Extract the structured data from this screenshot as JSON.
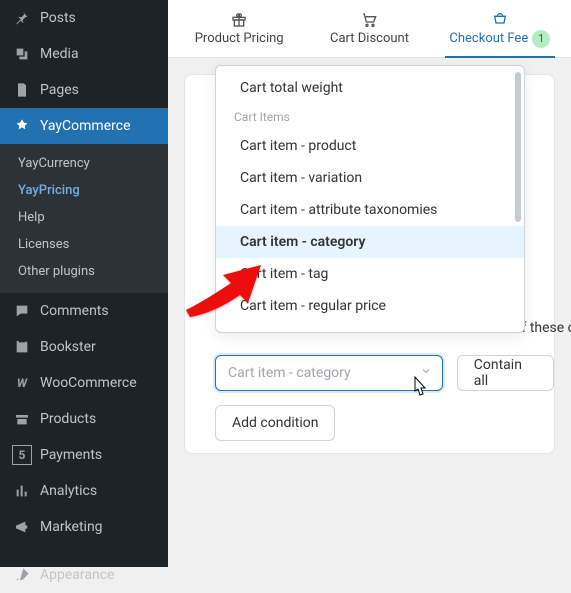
{
  "sidebar": {
    "items": [
      {
        "label": "Posts"
      },
      {
        "label": "Media"
      },
      {
        "label": "Pages"
      },
      {
        "label": "YayCommerce"
      },
      {
        "label": "Comments"
      },
      {
        "label": "Bookster"
      },
      {
        "label": "WooCommerce"
      },
      {
        "label": "Products"
      },
      {
        "label": "Payments"
      },
      {
        "label": "Analytics"
      },
      {
        "label": "Marketing"
      },
      {
        "label": "Appearance"
      }
    ],
    "submenu": [
      {
        "label": "YayCurrency"
      },
      {
        "label": "YayPricing"
      },
      {
        "label": "Help"
      },
      {
        "label": "Licenses"
      },
      {
        "label": "Other plugins"
      }
    ],
    "submenu_active_index": 1
  },
  "tabs": {
    "items": [
      {
        "label": "Product Pricing"
      },
      {
        "label": "Cart Discount"
      },
      {
        "label": "Checkout Fee",
        "badge": "1"
      }
    ],
    "active_index": 2
  },
  "dropdown": {
    "items": [
      {
        "type": "item",
        "label": "Cart total weight"
      },
      {
        "type": "group",
        "label": "Cart Items"
      },
      {
        "type": "item",
        "label": "Cart item - product"
      },
      {
        "type": "item",
        "label": "Cart item - variation"
      },
      {
        "type": "item",
        "label": "Cart item - attribute taxonomies"
      },
      {
        "type": "item",
        "label": "Cart item - category",
        "highlight": true
      },
      {
        "type": "item",
        "label": "Cart item - tag"
      },
      {
        "type": "item",
        "label": "Cart item - regular price"
      }
    ]
  },
  "condition_text": "of these conditi",
  "selected_condition": "Cart item - category",
  "contain_button": "Contain all",
  "add_condition": "Add condition"
}
